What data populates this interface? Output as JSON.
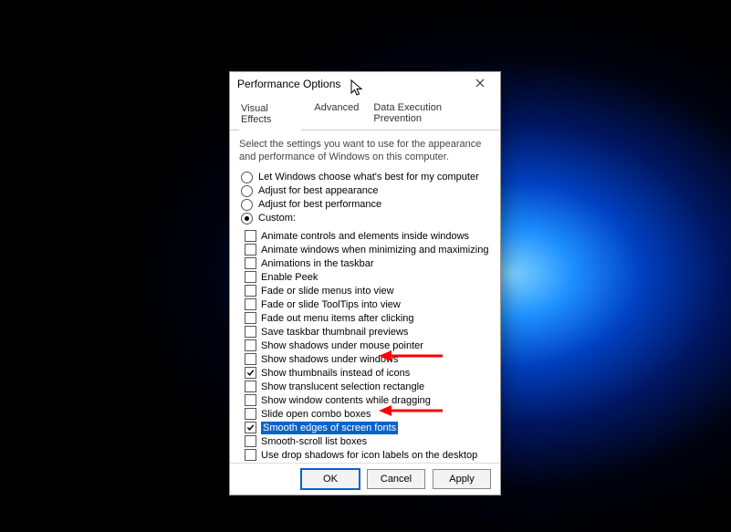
{
  "title": "Performance Options",
  "tabs": {
    "t0": "Visual Effects",
    "t1": "Advanced",
    "t2": "Data Execution Prevention"
  },
  "desc": "Select the settings you want to use for the appearance and performance of Windows on this computer.",
  "radios": {
    "r0": "Let Windows choose what's best for my computer",
    "r1": "Adjust for best appearance",
    "r2": "Adjust for best performance",
    "r3": "Custom:"
  },
  "items": {
    "i0": {
      "label": "Animate controls and elements inside windows",
      "checked": false
    },
    "i1": {
      "label": "Animate windows when minimizing and maximizing",
      "checked": false
    },
    "i2": {
      "label": "Animations in the taskbar",
      "checked": false
    },
    "i3": {
      "label": "Enable Peek",
      "checked": false
    },
    "i4": {
      "label": "Fade or slide menus into view",
      "checked": false
    },
    "i5": {
      "label": "Fade or slide ToolTips into view",
      "checked": false
    },
    "i6": {
      "label": "Fade out menu items after clicking",
      "checked": false
    },
    "i7": {
      "label": "Save taskbar thumbnail previews",
      "checked": false
    },
    "i8": {
      "label": "Show shadows under mouse pointer",
      "checked": false
    },
    "i9": {
      "label": "Show shadows under windows",
      "checked": false
    },
    "i10": {
      "label": "Show thumbnails instead of icons",
      "checked": true
    },
    "i11": {
      "label": "Show translucent selection rectangle",
      "checked": false
    },
    "i12": {
      "label": "Show window contents while dragging",
      "checked": false
    },
    "i13": {
      "label": "Slide open combo boxes",
      "checked": false
    },
    "i14": {
      "label": "Smooth edges of screen fonts",
      "checked": true
    },
    "i15": {
      "label": "Smooth-scroll list boxes",
      "checked": false
    },
    "i16": {
      "label": "Use drop shadows for icon labels on the desktop",
      "checked": false
    }
  },
  "buttons": {
    "ok": "OK",
    "cancel": "Cancel",
    "apply": "Apply"
  },
  "colors": {
    "highlight": "#0a63c9",
    "arrow": "#ff0000"
  }
}
